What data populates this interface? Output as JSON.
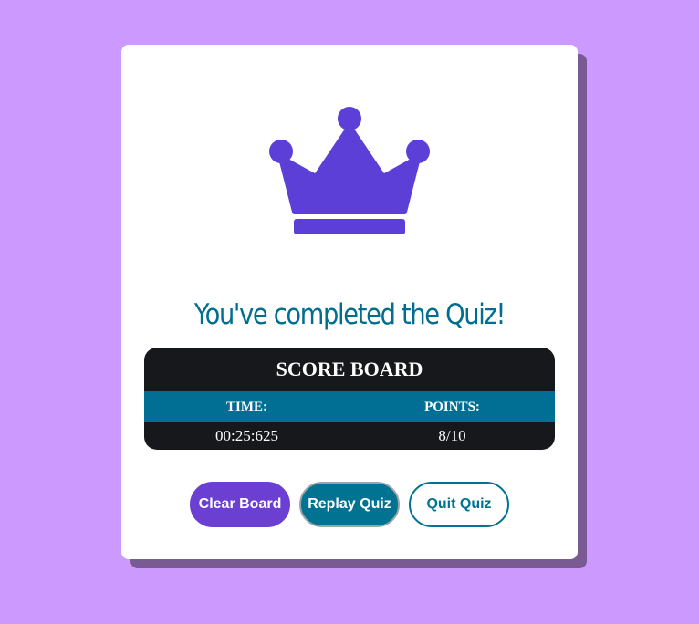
{
  "result": {
    "title": "You've completed the Quiz!"
  },
  "scoreboard": {
    "title": "SCORE BOARD",
    "time_label": "TIME:",
    "points_label": "POINTS:",
    "time_value": "00:25:625",
    "points_value": "8/10"
  },
  "actions": {
    "clear_label": "Clear Board",
    "replay_label": "Replay Quiz",
    "quit_label": "Quit Quiz"
  },
  "icons": {
    "crown": "crown-icon"
  },
  "colors": {
    "background": "#cc99ff",
    "crown": "#5c3fd6",
    "title": "#006f8f",
    "scoreboard_bg": "#17181c",
    "scoreboard_header": "#006f93",
    "clear_button": "#6a3fd2",
    "replay_button": "#007392"
  }
}
